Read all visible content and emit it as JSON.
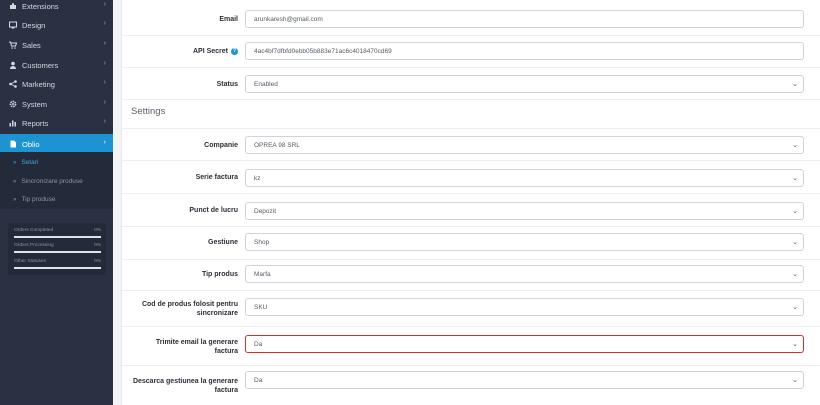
{
  "sidebar": {
    "items": [
      {
        "label": "Extensions",
        "icon": "puzzle-icon"
      },
      {
        "label": "Design",
        "icon": "monitor-icon"
      },
      {
        "label": "Sales",
        "icon": "cart-icon"
      },
      {
        "label": "Customers",
        "icon": "user-icon"
      },
      {
        "label": "Marketing",
        "icon": "share-icon"
      },
      {
        "label": "System",
        "icon": "gear-icon"
      },
      {
        "label": "Reports",
        "icon": "bar-chart-icon"
      },
      {
        "label": "Oblio",
        "icon": "file-icon"
      }
    ],
    "sub_items": [
      {
        "label": "Setari"
      },
      {
        "label": "Sincronizare produse"
      },
      {
        "label": "Tip produse"
      }
    ],
    "stats": [
      {
        "label": "Orders Completed",
        "value": "0%",
        "fill": 0
      },
      {
        "label": "Orders Processing",
        "value": "0%",
        "fill": 0
      },
      {
        "label": "Other Statuses",
        "value": "0%",
        "fill": 0
      }
    ],
    "accent": "#1d93d1",
    "background": "#2a3143"
  },
  "form": {
    "email": {
      "label": "Email",
      "value": "arunkaresh@gmail.com"
    },
    "api_secret": {
      "label": "API Secret",
      "value": "4ac4bf7dfbfd0ebb05b883e71ac6c4018470cd69"
    },
    "status": {
      "label": "Status",
      "value": "Enabled"
    },
    "settings_title": "Settings",
    "companie": {
      "label": "Companie",
      "value": "OPREA 98 SRL"
    },
    "serie_factura": {
      "label": "Serie factura",
      "value": "kz"
    },
    "punct_de_lucru": {
      "label": "Punct de lucru",
      "value": "Depozit"
    },
    "gestiune": {
      "label": "Gestiune",
      "value": "Shop"
    },
    "tip_produs": {
      "label": "Tip produs",
      "value": "Marfa"
    },
    "cod_produs": {
      "label_line1": "Cod de produs folosit pentru",
      "label_line2": "sincronizare",
      "value": "SKU"
    },
    "trimite_email": {
      "label_line1": "Trimite email la generare",
      "label_line2": "factura",
      "value": "Da"
    },
    "descarca_gestiunea": {
      "label_line1": "Descarca gestiunea la generare",
      "label_line2": "factura",
      "value": "Da"
    },
    "highlight_color": "#d32f2f"
  }
}
